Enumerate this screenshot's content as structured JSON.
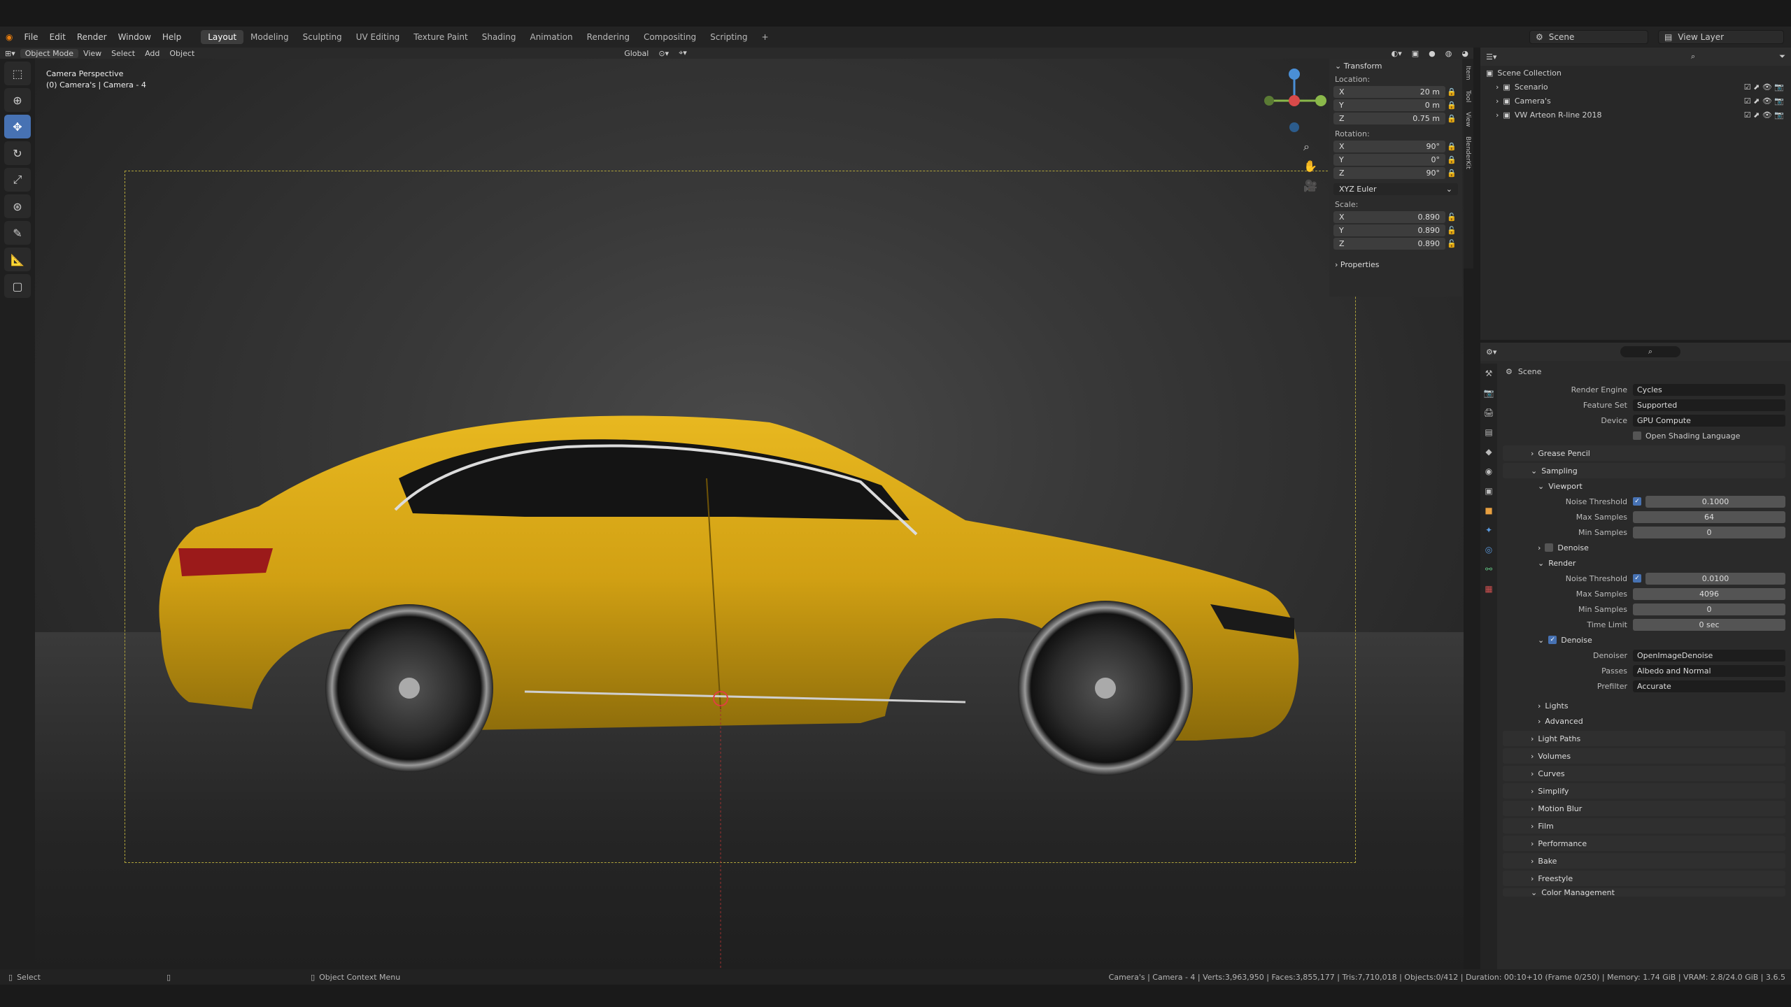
{
  "menus": [
    "File",
    "Edit",
    "Render",
    "Window",
    "Help"
  ],
  "workspaces": [
    "Layout",
    "Modeling",
    "Sculpting",
    "UV Editing",
    "Texture Paint",
    "Shading",
    "Animation",
    "Rendering",
    "Compositing",
    "Scripting"
  ],
  "add_tab": "+",
  "scene_label": "Scene",
  "view_layer": "View Layer",
  "header": {
    "mode": "Object Mode",
    "view": "View",
    "select": "Select",
    "add": "Add",
    "object": "Object",
    "transform": "Global"
  },
  "overlay": {
    "line1": "Camera Perspective",
    "line2": "(0) Camera's | Camera - 4"
  },
  "transform": {
    "title": "Transform",
    "location_label": "Location:",
    "location": [
      {
        "axis": "X",
        "value": "20 m"
      },
      {
        "axis": "Y",
        "value": "0 m"
      },
      {
        "axis": "Z",
        "value": "0.75 m"
      }
    ],
    "rotation_label": "Rotation:",
    "rotation": [
      {
        "axis": "X",
        "value": "90°"
      },
      {
        "axis": "Y",
        "value": "0°"
      },
      {
        "axis": "Z",
        "value": "90°"
      }
    ],
    "rotation_mode": "XYZ Euler",
    "scale_label": "Scale:",
    "scale": [
      {
        "axis": "X",
        "value": "0.890"
      },
      {
        "axis": "Y",
        "value": "0.890"
      },
      {
        "axis": "Z",
        "value": "0.890"
      }
    ],
    "properties": "Properties"
  },
  "ntabs": [
    "Item",
    "Tool",
    "View",
    "BlenderKit"
  ],
  "outliner": {
    "collection": "Scene Collection",
    "items": [
      "Scenario",
      "Camera's",
      "VW Arteon R-line 2018"
    ]
  },
  "props": {
    "scene": "Scene",
    "render_engine_label": "Render Engine",
    "render_engine": "Cycles",
    "feature_set_label": "Feature Set",
    "feature_set": "Supported",
    "device_label": "Device",
    "device": "GPU Compute",
    "osl": "Open Shading Language",
    "grease_pencil": "Grease Pencil",
    "sampling": "Sampling",
    "viewport": "Viewport",
    "noise_threshold_label": "Noise Threshold",
    "vp_noise": "0.1000",
    "max_samples_label": "Max Samples",
    "vp_max": "64",
    "min_samples_label": "Min Samples",
    "vp_min": "0",
    "denoise": "Denoise",
    "render": "Render",
    "r_noise": "0.0100",
    "r_max": "4096",
    "r_min": "0",
    "time_limit_label": "Time Limit",
    "r_time": "0 sec",
    "denoiser_label": "Denoiser",
    "denoiser": "OpenImageDenoise",
    "passes_label": "Passes",
    "passes": "Albedo and Normal",
    "prefilter_label": "Prefilter",
    "prefilter": "Accurate",
    "lights": "Lights",
    "advanced": "Advanced",
    "sections": [
      "Light Paths",
      "Volumes",
      "Curves",
      "Simplify",
      "Motion Blur",
      "Film",
      "Performance",
      "Bake",
      "Freestyle",
      "Color Management"
    ]
  },
  "status": {
    "select": "Select",
    "context": "Object Context Menu",
    "info": "Camera's | Camera - 4 | Verts:3,963,950 | Faces:3,855,177 | Tris:7,710,018 | Objects:0/412 | Duration: 00:10+10 (Frame 0/250) | Memory: 1.74 GiB | VRAM: 2.8/24.0 GiB | 3.6.5"
  },
  "colors": {
    "accent": "#4772b3",
    "car": "#d9a816",
    "frame": "#b0a33b"
  }
}
